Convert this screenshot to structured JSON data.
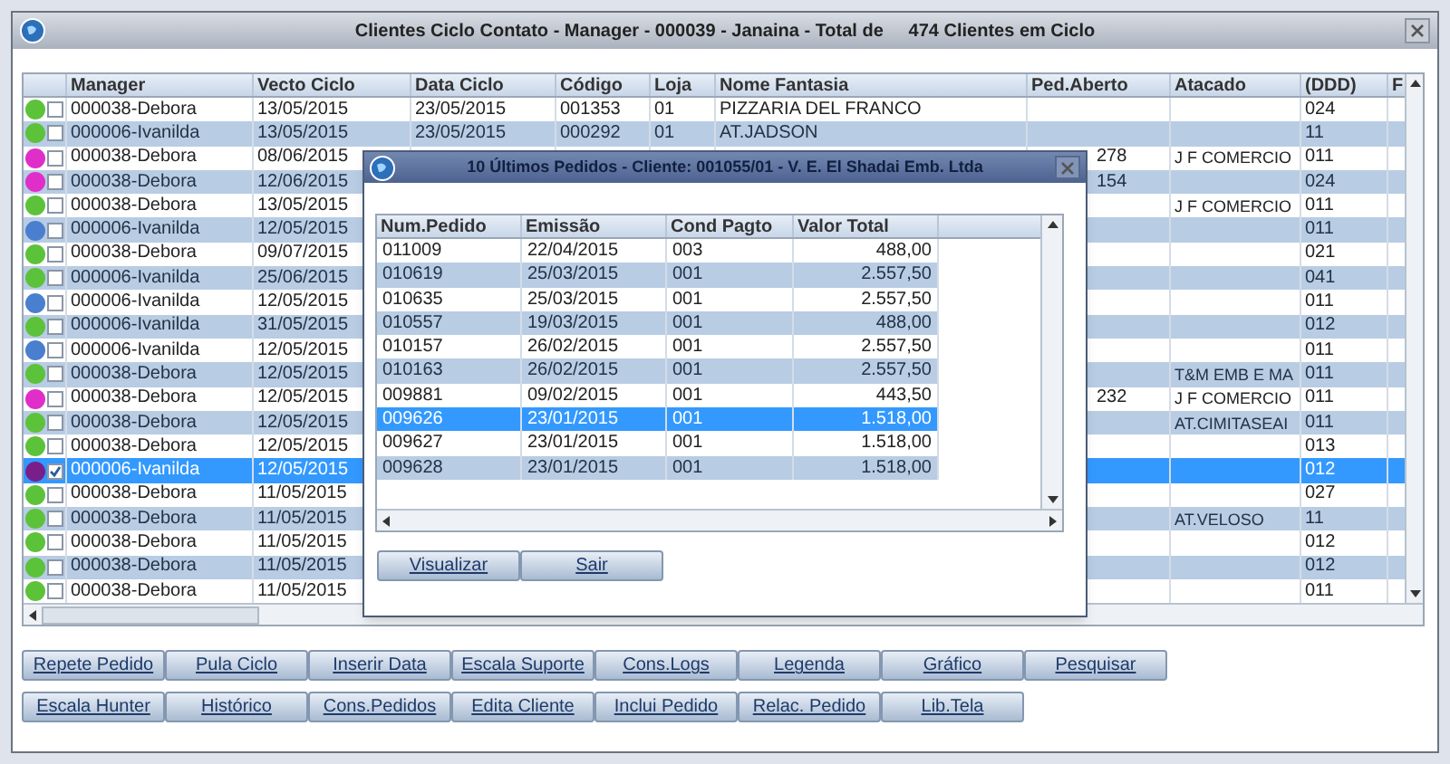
{
  "window": {
    "title": "Clientes Ciclo Contato - Manager - 000039 - Janaina - Total de     474 Clientes em Ciclo"
  },
  "table": {
    "columns": [
      "Manager",
      "Vecto Ciclo",
      "Data Ciclo",
      "Código",
      "Loja",
      "Nome Fantasia",
      "Ped.Aberto",
      "Atacado",
      "(DDD)",
      "F"
    ],
    "rows": [
      {
        "color": "#5cc23a",
        "checked": false,
        "selected": false,
        "manager": "000038-Debora",
        "vecto": "13/05/2015",
        "data": "23/05/2015",
        "codigo": "001353",
        "loja": "01",
        "nome": "PIZZARIA DEL FRANCO",
        "ddd": "024"
      },
      {
        "color": "#5cc23a",
        "checked": false,
        "selected": false,
        "manager": "000006-Ivanilda",
        "vecto": "13/05/2015",
        "data": "23/05/2015",
        "codigo": "000292",
        "loja": "01",
        "nome": "AT.JADSON",
        "ddd": "11"
      },
      {
        "color": "#e02ec8",
        "checked": false,
        "selected": false,
        "manager": "000038-Debora",
        "vecto": "08/06/2015",
        "ped": "278",
        "atacado": "J F COMERCIO",
        "ddd": "011"
      },
      {
        "color": "#e02ec8",
        "checked": false,
        "selected": false,
        "manager": "000038-Debora",
        "vecto": "12/06/2015",
        "ped": "154",
        "ddd": "024"
      },
      {
        "color": "#5cc23a",
        "checked": false,
        "selected": false,
        "manager": "000038-Debora",
        "vecto": "13/05/2015",
        "atacado": "J F COMERCIO",
        "ddd": "011"
      },
      {
        "color": "#4a7fcf",
        "checked": false,
        "selected": false,
        "manager": "000006-Ivanilda",
        "vecto": "12/05/2015",
        "ddd": "011"
      },
      {
        "color": "#5cc23a",
        "checked": false,
        "selected": false,
        "manager": "000038-Debora",
        "vecto": "09/07/2015",
        "ddd": "021"
      },
      {
        "color": "#5cc23a",
        "checked": false,
        "selected": false,
        "manager": "000006-Ivanilda",
        "vecto": "25/06/2015",
        "ddd": "041"
      },
      {
        "color": "#4a7fcf",
        "checked": false,
        "selected": false,
        "manager": "000006-Ivanilda",
        "vecto": "12/05/2015",
        "ddd": "011"
      },
      {
        "color": "#5cc23a",
        "checked": false,
        "selected": false,
        "manager": "000006-Ivanilda",
        "vecto": "31/05/2015",
        "ddd": "012"
      },
      {
        "color": "#4a7fcf",
        "checked": false,
        "selected": false,
        "manager": "000006-Ivanilda",
        "vecto": "12/05/2015",
        "ddd": "011"
      },
      {
        "color": "#5cc23a",
        "checked": false,
        "selected": false,
        "manager": "000038-Debora",
        "vecto": "12/05/2015",
        "atacado": "T&M EMB E MA",
        "ddd": "011"
      },
      {
        "color": "#e02ec8",
        "checked": false,
        "selected": false,
        "manager": "000038-Debora",
        "vecto": "12/05/2015",
        "ped": "232",
        "atacado": "J F COMERCIO",
        "ddd": "011"
      },
      {
        "color": "#5cc23a",
        "checked": false,
        "selected": false,
        "manager": "000038-Debora",
        "vecto": "12/05/2015",
        "atacado": "AT.CIMITASEAI",
        "ddd": "011"
      },
      {
        "color": "#5cc23a",
        "checked": false,
        "selected": false,
        "manager": "000038-Debora",
        "vecto": "12/05/2015",
        "ddd": "013"
      },
      {
        "color": "#7a1f8a",
        "checked": true,
        "selected": true,
        "manager": "000006-Ivanilda",
        "vecto": "12/05/2015",
        "ddd": "012"
      },
      {
        "color": "#5cc23a",
        "checked": false,
        "selected": false,
        "manager": "000038-Debora",
        "vecto": "11/05/2015",
        "ddd": "027"
      },
      {
        "color": "#5cc23a",
        "checked": false,
        "selected": false,
        "manager": "000038-Debora",
        "vecto": "11/05/2015",
        "atacado": "AT.VELOSO",
        "ddd": "11"
      },
      {
        "color": "#5cc23a",
        "checked": false,
        "selected": false,
        "manager": "000038-Debora",
        "vecto": "11/05/2015",
        "ddd": "012"
      },
      {
        "color": "#5cc23a",
        "checked": false,
        "selected": false,
        "manager": "000038-Debora",
        "vecto": "11/05/2015",
        "ddd": "012"
      },
      {
        "color": "#5cc23a",
        "checked": false,
        "selected": false,
        "manager": "000038-Debora",
        "vecto": "11/05/2015",
        "ddd": "011"
      }
    ]
  },
  "dialog": {
    "title": "10 Últimos Pedidos - Cliente: 001055/01 - V. E. El Shadai Emb. Ltda",
    "columns": [
      "Num.Pedido",
      "Emissão",
      "Cond Pagto",
      "Valor Total"
    ],
    "rows": [
      {
        "selected": false,
        "cells": [
          "011009",
          "22/04/2015",
          "003",
          "488,00"
        ]
      },
      {
        "selected": false,
        "cells": [
          "010619",
          "25/03/2015",
          "001",
          "2.557,50"
        ]
      },
      {
        "selected": false,
        "cells": [
          "010635",
          "25/03/2015",
          "001",
          "2.557,50"
        ]
      },
      {
        "selected": false,
        "cells": [
          "010557",
          "19/03/2015",
          "001",
          "488,00"
        ]
      },
      {
        "selected": false,
        "cells": [
          "010157",
          "26/02/2015",
          "001",
          "2.557,50"
        ]
      },
      {
        "selected": false,
        "cells": [
          "010163",
          "26/02/2015",
          "001",
          "2.557,50"
        ]
      },
      {
        "selected": false,
        "cells": [
          "009881",
          "09/02/2015",
          "001",
          "443,50"
        ]
      },
      {
        "selected": true,
        "cells": [
          "009626",
          "23/01/2015",
          "001",
          "1.518,00"
        ]
      },
      {
        "selected": false,
        "cells": [
          "009627",
          "23/01/2015",
          "001",
          "1.518,00"
        ]
      },
      {
        "selected": false,
        "cells": [
          "009628",
          "23/01/2015",
          "001",
          "1.518,00"
        ]
      }
    ],
    "buttons": [
      "Visualizar",
      "Sair"
    ]
  },
  "buttons": [
    [
      "Repete Pedido",
      "Pula Ciclo",
      "Inserir Data",
      "Escala Suporte",
      "Cons.Logs",
      "Legenda",
      "Gráfico",
      "Pesquisar"
    ],
    [
      "Escala Hunter",
      "Histórico",
      "Cons.Pedidos",
      "Edita Cliente",
      "Inclui Pedido",
      "Relac. Pedido",
      "Lib.Tela"
    ]
  ]
}
